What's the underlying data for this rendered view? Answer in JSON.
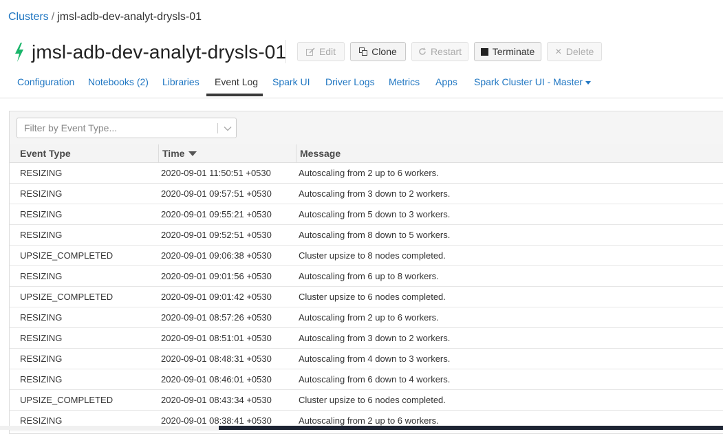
{
  "breadcrumb": {
    "root": "Clusters",
    "separator": "/",
    "current": "jmsl-adb-dev-analyt-drysls-01"
  },
  "header": {
    "title": "jmsl-adb-dev-analyt-drysls-01",
    "status_icon": "bolt-icon",
    "status_color": "#19b56a"
  },
  "actions": {
    "edit": "Edit",
    "clone": "Clone",
    "restart": "Restart",
    "terminate": "Terminate",
    "delete": "Delete"
  },
  "tabs": [
    {
      "label": "Configuration"
    },
    {
      "label": "Notebooks (2)"
    },
    {
      "label": "Libraries"
    },
    {
      "label": "Event Log",
      "active": true
    },
    {
      "label": "Spark UI"
    },
    {
      "label": "Driver Logs"
    },
    {
      "label": "Metrics"
    },
    {
      "label": "Apps"
    },
    {
      "label": "Spark Cluster UI - Master"
    }
  ],
  "filter": {
    "placeholder": "Filter by Event Type..."
  },
  "table": {
    "columns": [
      "Event Type",
      "Time",
      "Message"
    ],
    "sorted_by": "Time",
    "rows": [
      {
        "type": "RESIZING",
        "time": "2020-09-01 11:50:51 +0530",
        "message": "Autoscaling from 2 up to 6 workers."
      },
      {
        "type": "RESIZING",
        "time": "2020-09-01 09:57:51 +0530",
        "message": "Autoscaling from 3 down to 2 workers."
      },
      {
        "type": "RESIZING",
        "time": "2020-09-01 09:55:21 +0530",
        "message": "Autoscaling from 5 down to 3 workers."
      },
      {
        "type": "RESIZING",
        "time": "2020-09-01 09:52:51 +0530",
        "message": "Autoscaling from 8 down to 5 workers."
      },
      {
        "type": "UPSIZE_COMPLETED",
        "time": "2020-09-01 09:06:38 +0530",
        "message": "Cluster upsize to 8 nodes completed."
      },
      {
        "type": "RESIZING",
        "time": "2020-09-01 09:01:56 +0530",
        "message": "Autoscaling from 6 up to 8 workers."
      },
      {
        "type": "UPSIZE_COMPLETED",
        "time": "2020-09-01 09:01:42 +0530",
        "message": "Cluster upsize to 6 nodes completed."
      },
      {
        "type": "RESIZING",
        "time": "2020-09-01 08:57:26 +0530",
        "message": "Autoscaling from 2 up to 6 workers."
      },
      {
        "type": "RESIZING",
        "time": "2020-09-01 08:51:01 +0530",
        "message": "Autoscaling from 3 down to 2 workers."
      },
      {
        "type": "RESIZING",
        "time": "2020-09-01 08:48:31 +0530",
        "message": "Autoscaling from 4 down to 3 workers."
      },
      {
        "type": "RESIZING",
        "time": "2020-09-01 08:46:01 +0530",
        "message": "Autoscaling from 6 down to 4 workers."
      },
      {
        "type": "UPSIZE_COMPLETED",
        "time": "2020-09-01 08:43:34 +0530",
        "message": "Cluster upsize to 6 nodes completed."
      },
      {
        "type": "RESIZING",
        "time": "2020-09-01 08:38:41 +0530",
        "message": "Autoscaling from 2 up to 6 workers."
      }
    ]
  }
}
